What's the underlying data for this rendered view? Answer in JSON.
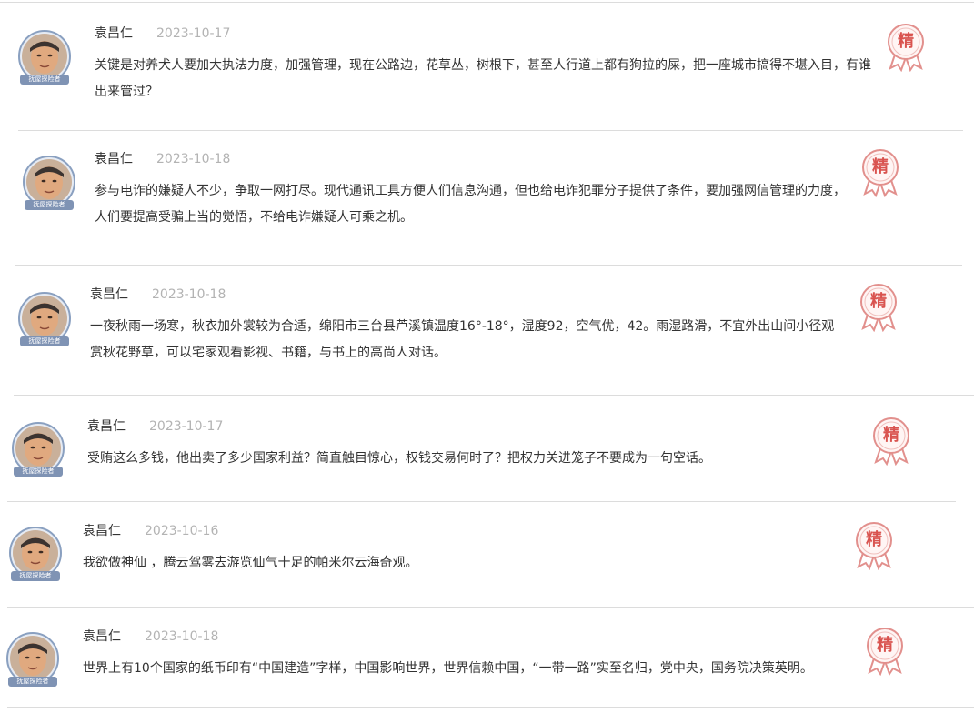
{
  "comments": [
    {
      "author": "袁昌仁",
      "date": "2023-10-17",
      "content": "关键是对养犬人要加大执法力度，加强管理，现在公路边，花草丛，树根下，甚至人行道上都有狗拉的屎，把一座城市搞得不堪入目，有谁出来管过？",
      "avatar_badge": "抚屋探险者",
      "featured_label": "精"
    },
    {
      "author": "袁昌仁",
      "date": "2023-10-18",
      "content": "参与电诈的嫌疑人不少，争取一网打尽。现代通讯工具方便人们信息沟通，但也给电诈犯罪分子提供了条件，要加强网信管理的力度，人们要提高受骗上当的觉悟，不给电诈嫌疑人可乘之机。",
      "avatar_badge": "抚屋探险者",
      "featured_label": "精"
    },
    {
      "author": "袁昌仁",
      "date": "2023-10-18",
      "content": "一夜秋雨一场寒，秋衣加外裳较为合适，绵阳市三台县芦溪镇温度16°-18°，湿度92，空气优，42。雨湿路滑，不宜外出山间小径观赏秋花野草，可以宅家观看影视、书籍，与书上的高尚人对话。",
      "avatar_badge": "抚屋探险者",
      "featured_label": "精"
    },
    {
      "author": "袁昌仁",
      "date": "2023-10-17",
      "content": "受贿这么多钱，他出卖了多少国家利益？简直触目惊心，权钱交易何时了？把权力关进笼子不要成为一句空话。",
      "avatar_badge": "抚屋探险者",
      "featured_label": "精"
    },
    {
      "author": "袁昌仁",
      "date": "2023-10-16",
      "content": "我欲做神仙 ，腾云驾雾去游览仙气十足的帕米尔云海奇观。",
      "avatar_badge": "抚屋探险者",
      "featured_label": "精"
    },
    {
      "author": "袁昌仁",
      "date": "2023-10-18",
      "content": "世界上有10个国家的纸币印有“中国建造”字样，中国影响世界，世界信赖中国，“一带一路”实至名归，党中央，国务院决策英明。",
      "avatar_badge": "抚屋探险者",
      "featured_label": "精"
    }
  ],
  "colors": {
    "badge_red": "#d9534f",
    "divider": "#dcdcdc",
    "date_gray": "#b3b3b3",
    "text": "#333333",
    "avatar_ring": "#8aa0c0"
  }
}
